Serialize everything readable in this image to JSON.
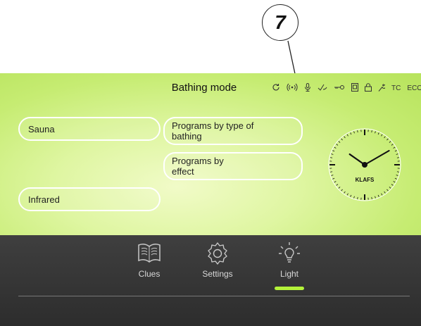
{
  "callout": {
    "number": "7"
  },
  "header": {
    "title": "Bathing mode",
    "status_icons": [
      {
        "name": "refresh-icon",
        "glyph": "⟳"
      },
      {
        "name": "wireless-icon",
        "glyph": "((•))"
      },
      {
        "name": "microphone-icon",
        "glyph": "🎙"
      },
      {
        "name": "ventilation-icon",
        "glyph": "✓"
      },
      {
        "name": "key-icon",
        "glyph": "⊸"
      },
      {
        "name": "device-icon",
        "glyph": "▣"
      },
      {
        "name": "lock-icon",
        "glyph": "🔒"
      },
      {
        "name": "wrench-icon",
        "glyph": "⚲"
      },
      {
        "name": "tc-icon",
        "glyph": "TC"
      },
      {
        "name": "eco-icon",
        "glyph": "ECO"
      }
    ]
  },
  "modes": {
    "sauna": "Sauna",
    "infrared": "Infrared",
    "programs_by_type_line1": "Programs by type of",
    "programs_by_type_line2": "bathing",
    "programs_by_effect_line1": "Programs by",
    "programs_by_effect_line2": "effect"
  },
  "clock": {
    "brand": "KLAFS",
    "time": "10:10"
  },
  "nav": {
    "items": [
      {
        "label": "Clues",
        "icon": "book-icon"
      },
      {
        "label": "Settings",
        "icon": "gear-icon"
      },
      {
        "label": "Light",
        "icon": "lightbulb-icon",
        "active": true
      }
    ]
  },
  "colors": {
    "accent": "#b4f23a",
    "panel_green": "#c6ec72",
    "bottom_bar": "#333333"
  }
}
